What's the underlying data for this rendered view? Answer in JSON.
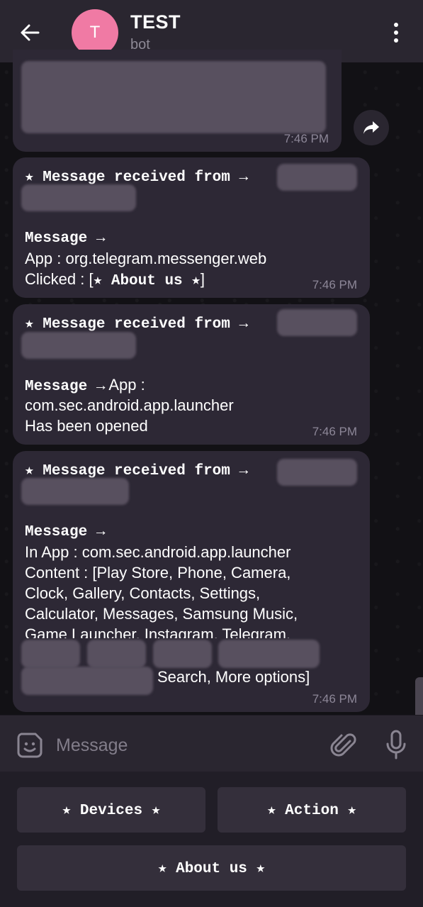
{
  "header": {
    "avatar_letter": "T",
    "title": "TEST",
    "subtitle": "bot"
  },
  "messages": [
    {
      "time": "7:46 PM"
    },
    {
      "header": "★ Message received from →",
      "label": "Message →",
      "lines": [
        "App : org.telegram.messenger.web",
        "Clicked : [",
        "★ About us ★",
        "]"
      ],
      "time": "7:46 PM"
    },
    {
      "header": "★ Message received from →",
      "label": "Message →",
      "label_suffix": " App :",
      "lines": [
        "com.sec.android.app.launcher",
        "Has been opened"
      ],
      "time": "7:46 PM"
    },
    {
      "header": "★ Message received from →",
      "label": "Message →",
      "lines": [
        "In App : com.sec.android.app.launcher",
        "Content : [Play Store, Phone, Camera,",
        "Clock, Gallery, Contacts, Settings,",
        "Calculator, Messages, Samsung Music,",
        "Game Launcher, Instagram, Telegram,",
        "Search, More options]"
      ],
      "time": "7:46 PM"
    }
  ],
  "composer": {
    "placeholder": "Message"
  },
  "keyboard": {
    "devices": "★ Devices ★",
    "action": "★ Action ★",
    "about": "★ About us ★"
  }
}
